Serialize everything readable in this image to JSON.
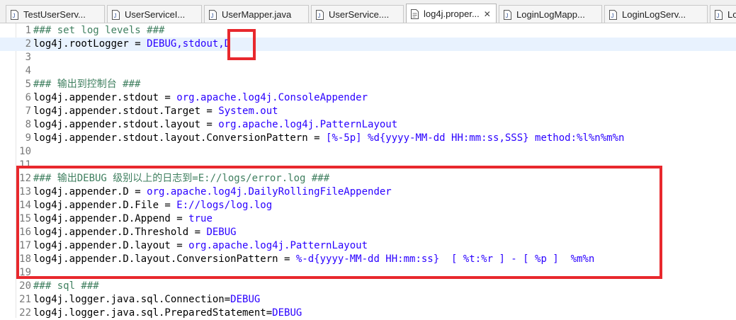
{
  "tabs": [
    {
      "label": "TestUserServ...",
      "active": false
    },
    {
      "label": "UserServiceI...",
      "active": false
    },
    {
      "label": "UserMapper.java",
      "active": false
    },
    {
      "label": "UserService....",
      "active": false
    },
    {
      "label": "log4j.proper...",
      "active": true
    },
    {
      "label": "LoginLogMapp...",
      "active": false
    },
    {
      "label": "LoginLogServ...",
      "active": false
    },
    {
      "label": "Lo",
      "active": false
    }
  ],
  "editor": {
    "lines": [
      {
        "num": "1",
        "parts": [
          {
            "t": "### set log levels ###",
            "c": "cm"
          }
        ]
      },
      {
        "num": "2",
        "parts": [
          {
            "t": "log4j.rootLogger = "
          },
          {
            "t": "DEBUG,stdout,D",
            "c": "val"
          }
        ]
      },
      {
        "num": "3",
        "parts": []
      },
      {
        "num": "4",
        "parts": []
      },
      {
        "num": "5",
        "parts": [
          {
            "t": "### ",
            "c": "cm"
          },
          {
            "t": "输出到控制台",
            "c": "cm cjk"
          },
          {
            "t": " ###",
            "c": "cm"
          }
        ]
      },
      {
        "num": "6",
        "parts": [
          {
            "t": "log4j.appender.stdout = "
          },
          {
            "t": "org.apache.log4j.ConsoleAppender",
            "c": "val"
          }
        ]
      },
      {
        "num": "7",
        "parts": [
          {
            "t": "log4j.appender.stdout.Target = "
          },
          {
            "t": "System.out",
            "c": "val"
          }
        ]
      },
      {
        "num": "8",
        "parts": [
          {
            "t": "log4j.appender.stdout.layout = "
          },
          {
            "t": "org.apache.log4j.PatternLayout",
            "c": "val"
          }
        ]
      },
      {
        "num": "9",
        "parts": [
          {
            "t": "log4j.appender.stdout.layout.ConversionPattern = "
          },
          {
            "t": "[%-5p] %d{yyyy-MM-dd HH:mm:ss,SSS} method:%l%n%m%n",
            "c": "val"
          }
        ]
      },
      {
        "num": "10",
        "parts": []
      },
      {
        "num": "11",
        "parts": []
      },
      {
        "num": "12",
        "parts": [
          {
            "t": "### ",
            "c": "cm"
          },
          {
            "t": "输出DEBUG 级别以上的日志到",
            "c": "cm cjk"
          },
          {
            "t": "=E://logs/error.log ###",
            "c": "cm"
          }
        ]
      },
      {
        "num": "13",
        "parts": [
          {
            "t": "log4j.appender.D = "
          },
          {
            "t": "org.apache.log4j.DailyRollingFileAppender",
            "c": "val"
          }
        ]
      },
      {
        "num": "14",
        "parts": [
          {
            "t": "log4j.appender.D.File = "
          },
          {
            "t": "E://logs/log.log",
            "c": "val"
          }
        ]
      },
      {
        "num": "15",
        "parts": [
          {
            "t": "log4j.appender.D.Append = "
          },
          {
            "t": "true",
            "c": "val"
          }
        ]
      },
      {
        "num": "16",
        "parts": [
          {
            "t": "log4j.appender.D.Threshold = "
          },
          {
            "t": "DEBUG",
            "c": "val"
          }
        ]
      },
      {
        "num": "17",
        "parts": [
          {
            "t": "log4j.appender.D.layout = "
          },
          {
            "t": "org.apache.log4j.PatternLayout",
            "c": "val"
          }
        ]
      },
      {
        "num": "18",
        "parts": [
          {
            "t": "log4j.appender.D.layout.ConversionPattern = "
          },
          {
            "t": "%-d{yyyy-MM-dd HH:mm:ss}  [ %t:%r ] - [ %p ]  %m%n",
            "c": "val"
          }
        ]
      },
      {
        "num": "19",
        "parts": []
      },
      {
        "num": "20",
        "parts": [
          {
            "t": "### sql ###",
            "c": "cm"
          }
        ]
      },
      {
        "num": "21",
        "parts": [
          {
            "t": "log4j.logger.java.sql.Connection="
          },
          {
            "t": "DEBUG",
            "c": "val"
          }
        ]
      },
      {
        "num": "22",
        "parts": [
          {
            "t": "log4j.logger.java.sql.PreparedStatement="
          },
          {
            "t": "DEBUG",
            "c": "val"
          }
        ]
      }
    ]
  }
}
